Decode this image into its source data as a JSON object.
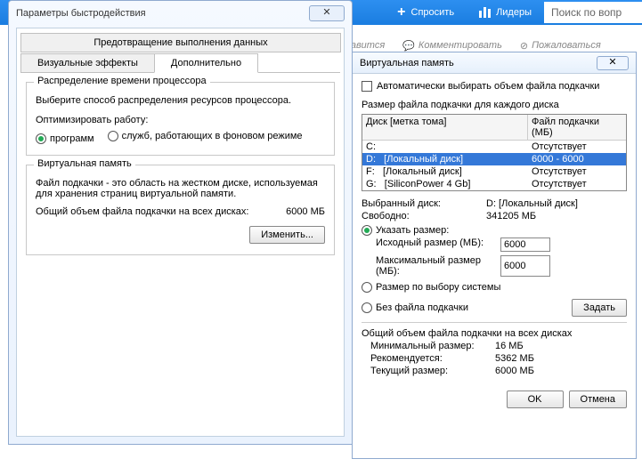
{
  "topbar": {
    "ask": "Спросить",
    "leaders": "Лидеры",
    "search_placeholder": "Поиск по вопр"
  },
  "social": {
    "like": "равится",
    "comment": "Комментировать",
    "report": "Пожаловаться"
  },
  "dlg1": {
    "title": "Параметры быстродействия",
    "tab_top": "Предотвращение выполнения данных",
    "tab1": "Визуальные эффекты",
    "tab2": "Дополнительно",
    "proc_legend": "Распределение времени процессора",
    "proc_desc": "Выберите способ распределения ресурсов процессора.",
    "opt_label": "Оптимизировать работу:",
    "r1": "программ",
    "r2": "служб, работающих в фоновом режиме",
    "vm_legend": "Виртуальная память",
    "vm_desc": "Файл подкачки - это область на жестком диске, используемая для хранения страниц виртуальной памяти.",
    "vm_total_label": "Общий объем файла подкачки на всех дисках:",
    "vm_total_val": "6000 МБ",
    "change_btn": "Изменить..."
  },
  "dlg2": {
    "title": "Виртуальная память",
    "auto_chk": "Автоматически выбирать объем файла подкачки",
    "size_each": "Размер файла подкачки для каждого диска",
    "hd1": "Диск [метка тома]",
    "hd2": "Файл подкачки (МБ)",
    "drives": [
      {
        "d": "C:",
        "l": "",
        "s": "Отсутствует"
      },
      {
        "d": "D:",
        "l": "[Локальный диск]",
        "s": "6000 - 6000"
      },
      {
        "d": "F:",
        "l": "[Локальный диск]",
        "s": "Отсутствует"
      },
      {
        "d": "G:",
        "l": "[SiliconPower 4 Gb]",
        "s": "Отсутствует"
      }
    ],
    "sel_label": "Выбранный диск:",
    "sel_val": "D:   [Локальный диск]",
    "free_label": "Свободно:",
    "free_val": "341205 МБ",
    "r_custom": "Указать размер:",
    "init_label": "Исходный размер (МБ):",
    "init_val": "6000",
    "max_label": "Максимальный размер (МБ):",
    "max_val": "6000",
    "r_system": "Размер по выбору системы",
    "r_none": "Без файла подкачки",
    "set_btn": "Задать",
    "total_legend": "Общий объем файла подкачки на всех дисках",
    "min_l": "Минимальный размер:",
    "min_v": "16 МБ",
    "rec_l": "Рекомендуется:",
    "rec_v": "5362 МБ",
    "cur_l": "Текущий размер:",
    "cur_v": "6000 МБ",
    "ok": "OK",
    "cancel": "Отмена"
  }
}
